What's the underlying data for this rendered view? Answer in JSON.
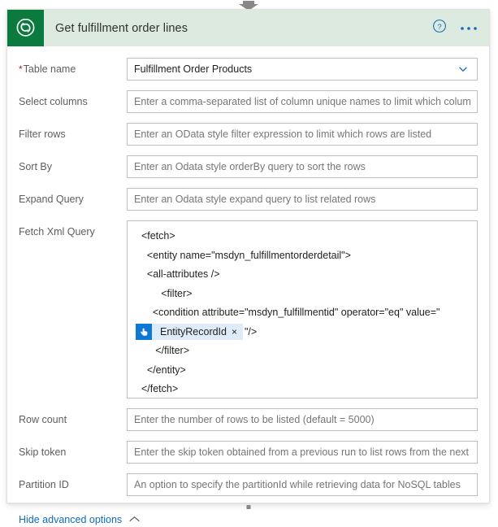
{
  "connectors": {
    "top_arrow_icon": "arrow-down-icon",
    "bottom_stub_icon": "connector-stub-icon"
  },
  "header": {
    "title": "Get fulfillment order lines",
    "app_icon": "dataverse-icon",
    "help_icon": "help-circle-icon",
    "more_icon": "ellipsis-icon",
    "more_label": "• • •",
    "background_color": "#dceadf",
    "icon_background_color": "#0b7a3f",
    "accent_color": "#0f6cbd"
  },
  "fields": {
    "table_name": {
      "label": "Table name",
      "required_marker": "*",
      "value": "Fulfillment Order Products",
      "chevron_icon": "chevron-down-icon"
    },
    "select_columns": {
      "label": "Select columns",
      "placeholder": "Enter a comma-separated list of column unique names to limit which columns are returned",
      "value": ""
    },
    "filter_rows": {
      "label": "Filter rows",
      "placeholder": "Enter an OData style filter expression to limit which rows are listed",
      "value": ""
    },
    "sort_by": {
      "label": "Sort By",
      "placeholder": "Enter an Odata style orderBy query to sort the rows",
      "value": ""
    },
    "expand_query": {
      "label": "Expand Query",
      "placeholder": "Enter an Odata style expand query to list related rows",
      "value": ""
    },
    "fetch_xml_query": {
      "label": "Fetch Xml Query",
      "lines_before_token": [
        "  <fetch>",
        "    <entity name=\"msdyn_fulfillmentorderdetail\">",
        "    <all-attributes />",
        "         <filter>",
        "      <condition attribute=\"msdyn_fulfillmentid\" operator=\"eq\" value=\""
      ],
      "token": {
        "label": "EntityRecordId",
        "icon": "touch-hand-icon",
        "close_label": "×",
        "icon_background_color": "#0f78d4",
        "chip_background_color": "#deecf9"
      },
      "text_after_token": "\"/>",
      "lines_after_token": [
        "       </filter>",
        "    </entity>",
        "  </fetch>"
      ]
    },
    "row_count": {
      "label": "Row count",
      "placeholder": "Enter the number of rows to be listed (default = 5000)",
      "value": ""
    },
    "skip_token": {
      "label": "Skip token",
      "placeholder": "Enter the skip token obtained from a previous run to list rows from the next page",
      "value": ""
    },
    "partition_id": {
      "label": "Partition ID",
      "placeholder": "An option to specify the partitionId while retrieving data for NoSQL tables",
      "value": ""
    }
  },
  "advanced_toggle": {
    "label": "Hide advanced options",
    "chevron_icon": "chevron-up-icon"
  }
}
